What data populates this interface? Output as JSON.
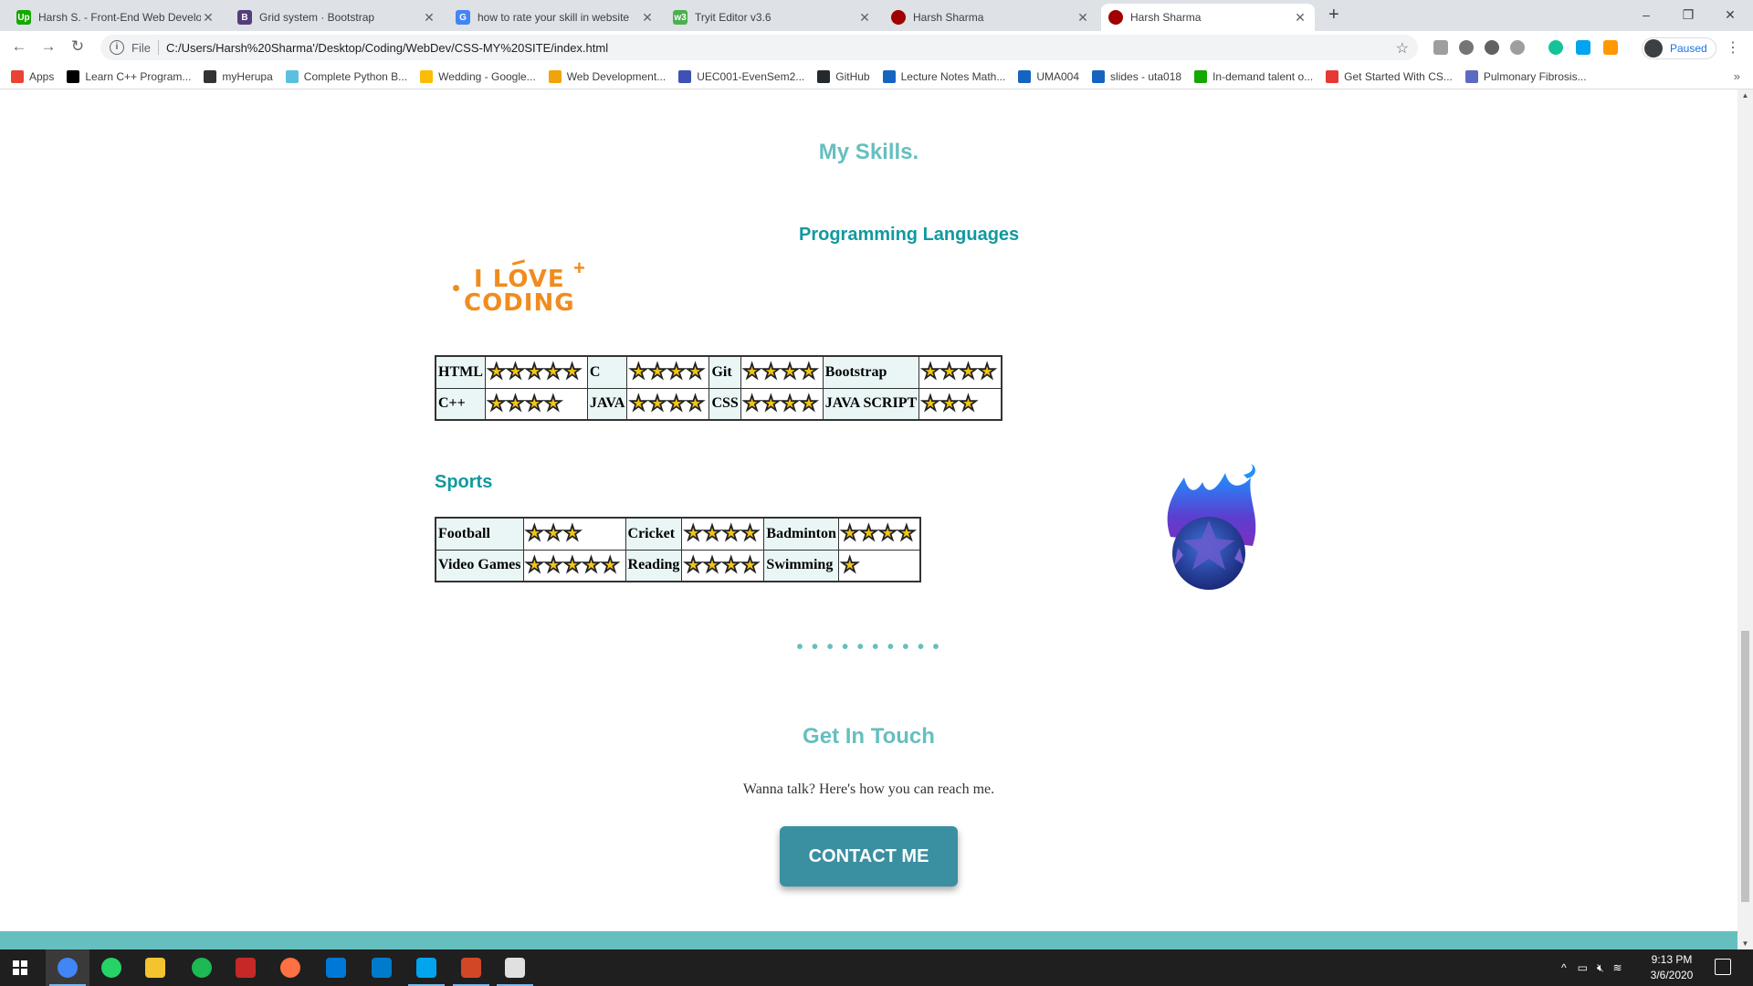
{
  "browser": {
    "tabs": [
      {
        "title": "Harsh S. - Front-End Web Develo",
        "favicon": "upwork-icon",
        "color": "#14a800",
        "glyph": "Up"
      },
      {
        "title": "Grid system · Bootstrap",
        "favicon": "bootstrap-icon",
        "color": "#563d7c",
        "glyph": "B"
      },
      {
        "title": "how to rate your skill in website",
        "favicon": "google-icon",
        "color": "#4285f4",
        "glyph": "G"
      },
      {
        "title": "Tryit Editor v3.6",
        "favicon": "w3schools-icon",
        "color": "#4caf50",
        "glyph": "w3"
      },
      {
        "title": "Harsh Sharma",
        "favicon": "site-icon",
        "color": "#a00000",
        "glyph": ""
      },
      {
        "title": "Harsh Sharma",
        "favicon": "site-icon",
        "color": "#a00000",
        "glyph": ""
      }
    ],
    "active_tab": 5,
    "new_tab_label": "+",
    "window_controls": {
      "minimize": "–",
      "restore": "❐",
      "close": "✕"
    },
    "address": {
      "scheme_label": "File",
      "url": "C:/Users/Harsh%20Sharma'/Desktop/Coding/WebDev/CSS-MY%20SITE/index.html"
    },
    "profile_label": "Paused",
    "bookmarks": [
      {
        "label": "Apps",
        "color": "#ea4335"
      },
      {
        "label": "Learn C++ Program...",
        "color": "#000000"
      },
      {
        "label": "myHerupa",
        "color": "#333333"
      },
      {
        "label": "Complete Python B...",
        "color": "#5bc0de"
      },
      {
        "label": "Wedding - Google...",
        "color": "#fbbc05"
      },
      {
        "label": "Web Development...",
        "color": "#f0a30a"
      },
      {
        "label": "UEC001-EvenSem2...",
        "color": "#3f51b5"
      },
      {
        "label": "GitHub",
        "color": "#24292e"
      },
      {
        "label": "Lecture Notes Math...",
        "color": "#1565c0"
      },
      {
        "label": "UMA004",
        "color": "#1565c0"
      },
      {
        "label": "slides - uta018",
        "color": "#1565c0"
      },
      {
        "label": "In-demand talent o...",
        "color": "#14a800"
      },
      {
        "label": "Get Started With CS...",
        "color": "#e53935"
      },
      {
        "label": "Pulmonary Fibrosis...",
        "color": "#5c6bc0"
      }
    ],
    "bookmarks_more": "»"
  },
  "page": {
    "skills_title": "My Skills.",
    "programming_title": "Programming Languages",
    "ilove_line1": "I LOVE",
    "ilove_line2": "CODING",
    "programming_table": [
      [
        {
          "label": "HTML",
          "stars": 5
        },
        {
          "label": "C",
          "stars": 4
        },
        {
          "label": "Git",
          "stars": 4
        },
        {
          "label": "Bootstrap",
          "stars": 4
        }
      ],
      [
        {
          "label": "C++",
          "stars": 4
        },
        {
          "label": "JAVA",
          "stars": 4
        },
        {
          "label": "CSS",
          "stars": 4
        },
        {
          "label": "JAVA SCRIPT",
          "stars": 3
        }
      ]
    ],
    "sports_title": "Sports",
    "sports_table": [
      [
        {
          "label": "Football",
          "stars": 3
        },
        {
          "label": "Cricket",
          "stars": 4
        },
        {
          "label": "Badminton",
          "stars": 4
        }
      ],
      [
        {
          "label": "Video Games",
          "stars": 5
        },
        {
          "label": "Reading",
          "stars": 4
        },
        {
          "label": "Swimming",
          "stars": 1
        }
      ]
    ],
    "divider_dots": "• • • • • • • • • •",
    "touch_title": "Get In Touch",
    "touch_text": "Wanna talk? Here's how you can reach me.",
    "contact_button": "CONTACT ME",
    "colors": {
      "heading": "#66bfbf",
      "subheading": "#11999e",
      "button": "#3a8fa1",
      "star": "#f5c518"
    }
  },
  "taskbar": {
    "apps": [
      {
        "name": "chrome-icon",
        "color": "#4285f4",
        "active": true
      },
      {
        "name": "whatsapp-icon",
        "color": "#25d366",
        "active": false
      },
      {
        "name": "file-explorer-icon",
        "color": "#f4c430",
        "active": false
      },
      {
        "name": "spotify-icon",
        "color": "#1db954",
        "active": false
      },
      {
        "name": "game-icon",
        "color": "#c62828",
        "active": false
      },
      {
        "name": "app-icon",
        "color": "#ff7043",
        "active": false
      },
      {
        "name": "mail-icon",
        "color": "#0078d7",
        "active": false
      },
      {
        "name": "vscode-icon",
        "color": "#007acc",
        "active": false
      },
      {
        "name": "snip-icon",
        "color": "#00a4ef",
        "active": true
      },
      {
        "name": "powerpoint-icon",
        "color": "#d24726",
        "active": true
      },
      {
        "name": "photos-icon",
        "color": "#e0e0e0",
        "active": true
      }
    ],
    "time": "9:13 PM",
    "date": "3/6/2020"
  }
}
